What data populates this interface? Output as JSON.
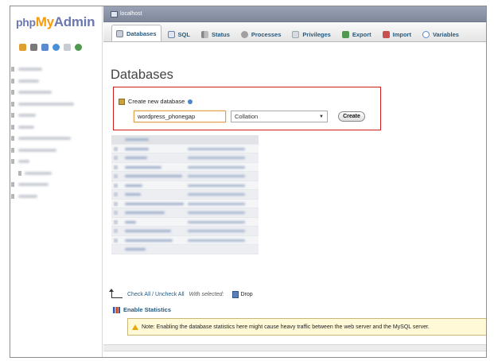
{
  "logo": {
    "php": "php",
    "my": "My",
    "admin": "Admin"
  },
  "nav_icons": [
    "home-icon",
    "docs-icon",
    "sql-icon",
    "help-icon",
    "copy-icon",
    "settings-icon"
  ],
  "topbar": {
    "server": "localhost"
  },
  "tabs": [
    {
      "label": "Databases",
      "icon": "database-icon",
      "active": true
    },
    {
      "label": "SQL",
      "icon": "sql-icon",
      "active": false
    },
    {
      "label": "Status",
      "icon": "status-icon",
      "active": false
    },
    {
      "label": "Processes",
      "icon": "processes-icon",
      "active": false
    },
    {
      "label": "Privileges",
      "icon": "privileges-icon",
      "active": false
    },
    {
      "label": "Export",
      "icon": "export-icon",
      "active": false
    },
    {
      "label": "Import",
      "icon": "import-icon",
      "active": false
    },
    {
      "label": "Variables",
      "icon": "variables-icon",
      "active": false
    }
  ],
  "main": {
    "title": "Databases",
    "create": {
      "label": "Create new database",
      "db_name_value": "wordpress_phonegap",
      "collation_value": "Collation",
      "button": "Create"
    },
    "check_all": "Check All / Uncheck All",
    "with_selected": "With selected:",
    "drop": "Drop",
    "enable_stats": "Enable Statistics",
    "notice": "Note: Enabling the database statistics here might cause heavy traffic between the web server and the MySQL server."
  },
  "colors": {
    "logo_blue": "#6c78af",
    "logo_orange": "#f89c0e",
    "highlight_red": "#d01c1c",
    "link": "#235a81"
  }
}
